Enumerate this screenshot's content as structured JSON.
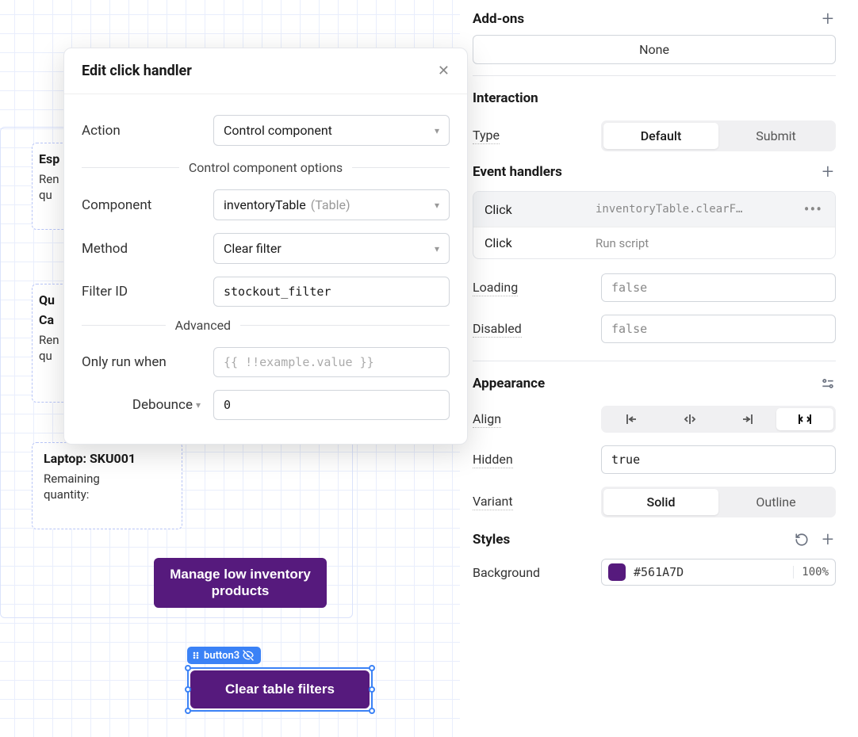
{
  "canvas": {
    "cards": [
      {
        "title": "Esp",
        "line1": "Ren",
        "line2": "qu"
      },
      {
        "title_l1": "Qu",
        "title_l2": "Ca",
        "line1": "Ren",
        "line2": "qu"
      },
      {
        "title": "Laptop: SKU001",
        "line1": "Remaining",
        "line2": "quantity:"
      }
    ],
    "manage_button": "Manage low inventory products",
    "selected_component_label": "button3",
    "clear_button": "Clear table filters"
  },
  "modal": {
    "title": "Edit click handler",
    "action_label": "Action",
    "action_value": "Control component",
    "options_header": "Control component options",
    "component_label": "Component",
    "component_value": "inventoryTable",
    "component_hint": "(Table)",
    "method_label": "Method",
    "method_value": "Clear filter",
    "filter_id_label": "Filter ID",
    "filter_id_value": "stockout_filter",
    "advanced_header": "Advanced",
    "only_run_label": "Only run when",
    "only_run_placeholder": "{{ !!example.value }}",
    "debounce_label": "Debounce",
    "debounce_value": "0"
  },
  "inspector": {
    "addons": {
      "header": "Add-ons",
      "none_value": "None"
    },
    "interaction": {
      "header": "Interaction",
      "type_label": "Type",
      "type_options": [
        "Default",
        "Submit"
      ],
      "type_selected": 0,
      "event_handlers_header": "Event handlers",
      "handlers": [
        {
          "event": "Click",
          "target": "inventoryTable.clearF…",
          "selected": true,
          "mono": true
        },
        {
          "event": "Click",
          "target": "Run script",
          "selected": false,
          "mono": false
        }
      ],
      "loading_label": "Loading",
      "loading_value": "false",
      "disabled_label": "Disabled",
      "disabled_value": "false"
    },
    "appearance": {
      "header": "Appearance",
      "align_label": "Align",
      "hidden_label": "Hidden",
      "hidden_value": "true",
      "variant_label": "Variant",
      "variant_options": [
        "Solid",
        "Outline"
      ],
      "variant_selected": 0,
      "styles_label": "Styles",
      "background_label": "Background",
      "background_color": "#561A7D",
      "background_opacity": "100%"
    }
  }
}
